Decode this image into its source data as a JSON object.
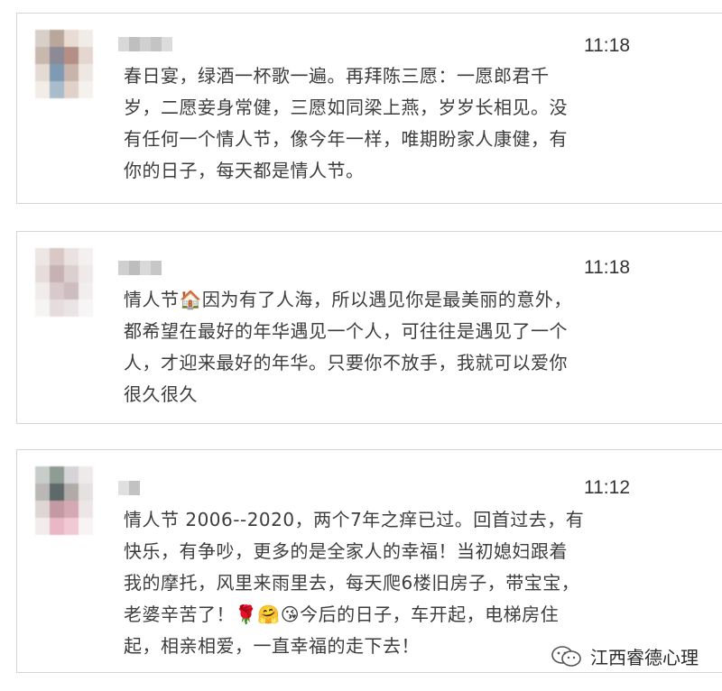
{
  "comments": [
    {
      "time": "11:18",
      "lines": [
        "春日宴，绿酒一杯歌一遍。再拜陈三愿：一愿郎君千",
        "岁，二愿妾身常健，三愿如同梁上燕，岁岁长相见。没",
        "有任何一个情人节，像今年一样，唯期盼家人康健，有",
        "你的日子，每天都是情人节。"
      ]
    },
    {
      "time": "11:18",
      "lines": [
        "情人节🏠因为有了人海，所以遇见你是最美丽的意外，",
        "都希望在最好的年华遇见一个人，可往往是遇见了一个",
        "人，才迎来最好的年华。只要你不放手，我就可以爱你",
        "很久很久"
      ]
    },
    {
      "time": "11:12",
      "lines": [
        "情人节 2006--2020，两个7年之痒已过。回首过去，有",
        "快乐，有争吵，更多的是全家人的幸福！当初媳妇跟着",
        "我的摩托，风里来雨里去，每天爬6楼旧房子，带宝宝，",
        "老婆辛苦了！🌹🤗😘今后的日子，车开起，电梯房住",
        "起，相亲相爱，一直幸福的走下去！"
      ]
    }
  ],
  "watermark": {
    "text": "江西睿德心理",
    "icon": "wechat-official-account-icon"
  }
}
